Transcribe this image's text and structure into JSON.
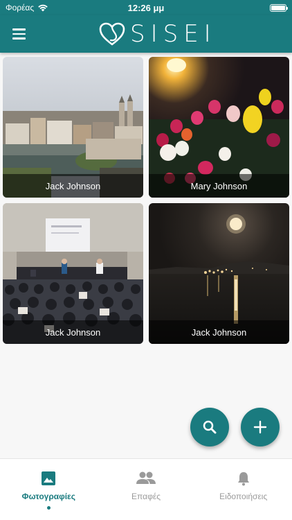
{
  "status_bar": {
    "carrier": "Φορέας",
    "time": "12:26 μμ"
  },
  "app_bar": {
    "logo_text": "SISEI"
  },
  "colors": {
    "primary": "#1a7b7f",
    "inactive": "#9a9a9a"
  },
  "photos": [
    {
      "owner": "Jack Johnson",
      "scene": "city-river"
    },
    {
      "owner": "Mary Johnson",
      "scene": "tulips"
    },
    {
      "owner": "Jack Johnson",
      "scene": "conference"
    },
    {
      "owner": "Jack Johnson",
      "scene": "moon-lake"
    }
  ],
  "fabs": {
    "search_icon": "search-icon",
    "add_icon": "plus-icon"
  },
  "bottom_nav": [
    {
      "label": "Φωτογραφίες",
      "icon": "image-icon",
      "active": true
    },
    {
      "label": "Επαφές",
      "icon": "people-icon",
      "active": false
    },
    {
      "label": "Ειδοποιήσεις",
      "icon": "bell-icon",
      "active": false
    }
  ]
}
